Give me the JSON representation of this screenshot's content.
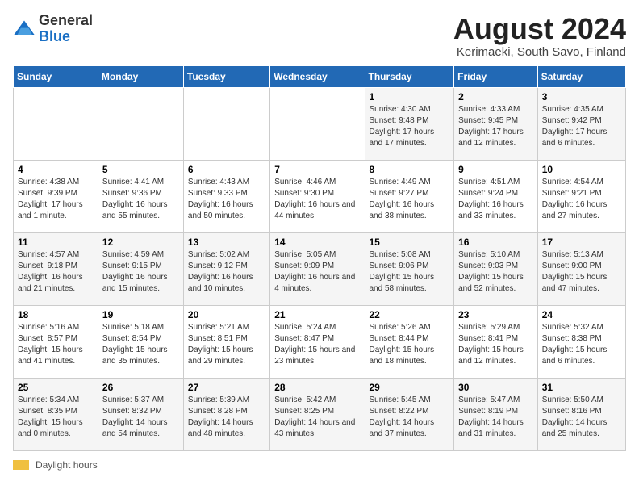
{
  "logo": {
    "general": "General",
    "blue": "Blue"
  },
  "title": "August 2024",
  "subtitle": "Kerimaeki, South Savo, Finland",
  "days_of_week": [
    "Sunday",
    "Monday",
    "Tuesday",
    "Wednesday",
    "Thursday",
    "Friday",
    "Saturday"
  ],
  "footer": {
    "label": "Daylight hours"
  },
  "weeks": [
    [
      {
        "num": "",
        "sunrise": "",
        "sunset": "",
        "daylight": ""
      },
      {
        "num": "",
        "sunrise": "",
        "sunset": "",
        "daylight": ""
      },
      {
        "num": "",
        "sunrise": "",
        "sunset": "",
        "daylight": ""
      },
      {
        "num": "",
        "sunrise": "",
        "sunset": "",
        "daylight": ""
      },
      {
        "num": "1",
        "sunrise": "Sunrise: 4:30 AM",
        "sunset": "Sunset: 9:48 PM",
        "daylight": "Daylight: 17 hours and 17 minutes."
      },
      {
        "num": "2",
        "sunrise": "Sunrise: 4:33 AM",
        "sunset": "Sunset: 9:45 PM",
        "daylight": "Daylight: 17 hours and 12 minutes."
      },
      {
        "num": "3",
        "sunrise": "Sunrise: 4:35 AM",
        "sunset": "Sunset: 9:42 PM",
        "daylight": "Daylight: 17 hours and 6 minutes."
      }
    ],
    [
      {
        "num": "4",
        "sunrise": "Sunrise: 4:38 AM",
        "sunset": "Sunset: 9:39 PM",
        "daylight": "Daylight: 17 hours and 1 minute."
      },
      {
        "num": "5",
        "sunrise": "Sunrise: 4:41 AM",
        "sunset": "Sunset: 9:36 PM",
        "daylight": "Daylight: 16 hours and 55 minutes."
      },
      {
        "num": "6",
        "sunrise": "Sunrise: 4:43 AM",
        "sunset": "Sunset: 9:33 PM",
        "daylight": "Daylight: 16 hours and 50 minutes."
      },
      {
        "num": "7",
        "sunrise": "Sunrise: 4:46 AM",
        "sunset": "Sunset: 9:30 PM",
        "daylight": "Daylight: 16 hours and 44 minutes."
      },
      {
        "num": "8",
        "sunrise": "Sunrise: 4:49 AM",
        "sunset": "Sunset: 9:27 PM",
        "daylight": "Daylight: 16 hours and 38 minutes."
      },
      {
        "num": "9",
        "sunrise": "Sunrise: 4:51 AM",
        "sunset": "Sunset: 9:24 PM",
        "daylight": "Daylight: 16 hours and 33 minutes."
      },
      {
        "num": "10",
        "sunrise": "Sunrise: 4:54 AM",
        "sunset": "Sunset: 9:21 PM",
        "daylight": "Daylight: 16 hours and 27 minutes."
      }
    ],
    [
      {
        "num": "11",
        "sunrise": "Sunrise: 4:57 AM",
        "sunset": "Sunset: 9:18 PM",
        "daylight": "Daylight: 16 hours and 21 minutes."
      },
      {
        "num": "12",
        "sunrise": "Sunrise: 4:59 AM",
        "sunset": "Sunset: 9:15 PM",
        "daylight": "Daylight: 16 hours and 15 minutes."
      },
      {
        "num": "13",
        "sunrise": "Sunrise: 5:02 AM",
        "sunset": "Sunset: 9:12 PM",
        "daylight": "Daylight: 16 hours and 10 minutes."
      },
      {
        "num": "14",
        "sunrise": "Sunrise: 5:05 AM",
        "sunset": "Sunset: 9:09 PM",
        "daylight": "Daylight: 16 hours and 4 minutes."
      },
      {
        "num": "15",
        "sunrise": "Sunrise: 5:08 AM",
        "sunset": "Sunset: 9:06 PM",
        "daylight": "Daylight: 15 hours and 58 minutes."
      },
      {
        "num": "16",
        "sunrise": "Sunrise: 5:10 AM",
        "sunset": "Sunset: 9:03 PM",
        "daylight": "Daylight: 15 hours and 52 minutes."
      },
      {
        "num": "17",
        "sunrise": "Sunrise: 5:13 AM",
        "sunset": "Sunset: 9:00 PM",
        "daylight": "Daylight: 15 hours and 47 minutes."
      }
    ],
    [
      {
        "num": "18",
        "sunrise": "Sunrise: 5:16 AM",
        "sunset": "Sunset: 8:57 PM",
        "daylight": "Daylight: 15 hours and 41 minutes."
      },
      {
        "num": "19",
        "sunrise": "Sunrise: 5:18 AM",
        "sunset": "Sunset: 8:54 PM",
        "daylight": "Daylight: 15 hours and 35 minutes."
      },
      {
        "num": "20",
        "sunrise": "Sunrise: 5:21 AM",
        "sunset": "Sunset: 8:51 PM",
        "daylight": "Daylight: 15 hours and 29 minutes."
      },
      {
        "num": "21",
        "sunrise": "Sunrise: 5:24 AM",
        "sunset": "Sunset: 8:47 PM",
        "daylight": "Daylight: 15 hours and 23 minutes."
      },
      {
        "num": "22",
        "sunrise": "Sunrise: 5:26 AM",
        "sunset": "Sunset: 8:44 PM",
        "daylight": "Daylight: 15 hours and 18 minutes."
      },
      {
        "num": "23",
        "sunrise": "Sunrise: 5:29 AM",
        "sunset": "Sunset: 8:41 PM",
        "daylight": "Daylight: 15 hours and 12 minutes."
      },
      {
        "num": "24",
        "sunrise": "Sunrise: 5:32 AM",
        "sunset": "Sunset: 8:38 PM",
        "daylight": "Daylight: 15 hours and 6 minutes."
      }
    ],
    [
      {
        "num": "25",
        "sunrise": "Sunrise: 5:34 AM",
        "sunset": "Sunset: 8:35 PM",
        "daylight": "Daylight: 15 hours and 0 minutes."
      },
      {
        "num": "26",
        "sunrise": "Sunrise: 5:37 AM",
        "sunset": "Sunset: 8:32 PM",
        "daylight": "Daylight: 14 hours and 54 minutes."
      },
      {
        "num": "27",
        "sunrise": "Sunrise: 5:39 AM",
        "sunset": "Sunset: 8:28 PM",
        "daylight": "Daylight: 14 hours and 48 minutes."
      },
      {
        "num": "28",
        "sunrise": "Sunrise: 5:42 AM",
        "sunset": "Sunset: 8:25 PM",
        "daylight": "Daylight: 14 hours and 43 minutes."
      },
      {
        "num": "29",
        "sunrise": "Sunrise: 5:45 AM",
        "sunset": "Sunset: 8:22 PM",
        "daylight": "Daylight: 14 hours and 37 minutes."
      },
      {
        "num": "30",
        "sunrise": "Sunrise: 5:47 AM",
        "sunset": "Sunset: 8:19 PM",
        "daylight": "Daylight: 14 hours and 31 minutes."
      },
      {
        "num": "31",
        "sunrise": "Sunrise: 5:50 AM",
        "sunset": "Sunset: 8:16 PM",
        "daylight": "Daylight: 14 hours and 25 minutes."
      }
    ]
  ]
}
